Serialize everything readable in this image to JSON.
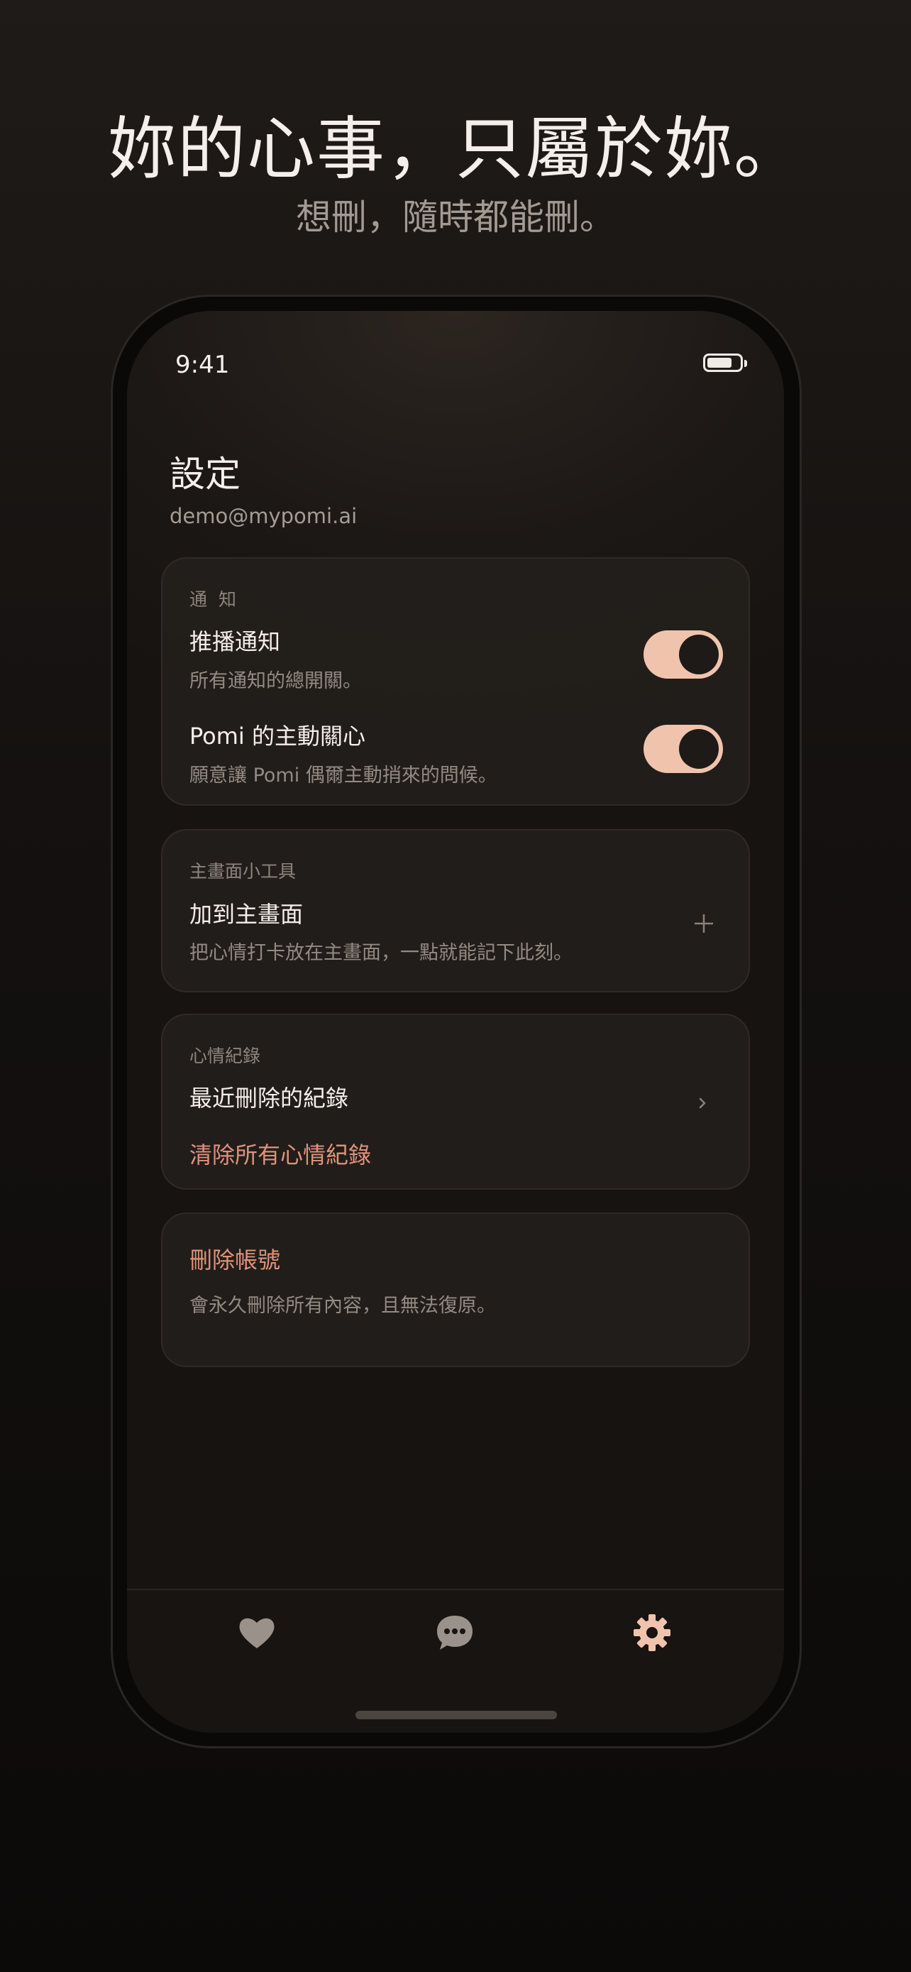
{
  "hero": {
    "title": "妳的心事，只屬於妳。",
    "subtitle": "想刪，隨時都能刪。"
  },
  "status_bar": {
    "time": "9:41",
    "battery_icon": "battery-icon"
  },
  "header": {
    "title": "設定",
    "email": "demo@mypomi.ai"
  },
  "notifications": {
    "label": "通 知",
    "rows": [
      {
        "title": "推播通知",
        "description": "所有通知的總開關。",
        "enabled": true
      },
      {
        "title": "Pomi 的主動關心",
        "description": "願意讓 Pomi 偶爾主動捎來的問候。",
        "enabled": true
      }
    ]
  },
  "widget": {
    "label": "主畫面小工具",
    "title": "加到主畫面",
    "description": "把心情打卡放在主畫面，一點就能記下此刻。",
    "icon": "plus-icon"
  },
  "mood_records": {
    "label": "心情紀錄",
    "recently_deleted": "最近刪除的紀錄",
    "clear_all": "清除所有心情紀錄",
    "icon": "chevron-right-icon"
  },
  "account": {
    "delete_title": "刪除帳號",
    "delete_description": "會永久刪除所有內容，且無法復原。"
  },
  "tab_bar": {
    "tabs": [
      {
        "icon": "heart-icon",
        "active": false
      },
      {
        "icon": "chat-bubble-icon",
        "active": false
      },
      {
        "icon": "gear-icon",
        "active": true
      }
    ]
  },
  "colors": {
    "accent": "#f0c4ac",
    "danger": "#e0927c",
    "background": "#141110",
    "inactive_icon": "#9a918a"
  }
}
